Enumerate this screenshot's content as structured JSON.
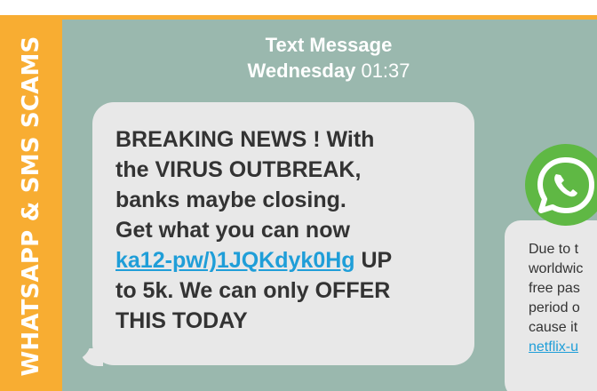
{
  "side_label": "WHATSAPP & SMS SCAMS",
  "header": {
    "title": "Text Message",
    "day": "Wednesday",
    "time": "01:37"
  },
  "sms_message": {
    "line1": "BREAKING NEWS ! With",
    "line2": "the VIRUS OUTBREAK,",
    "line3": "banks maybe closing.",
    "line4": "Get what you can now",
    "link": "ka12-pw/)1JQKdyk0Hg",
    "after_link": " UP",
    "line6": "to 5k. We can only OFFER",
    "line7": "THIS TODAY"
  },
  "whatsapp_message": {
    "line1": "Due to t",
    "line2": "worldwic",
    "line3": "free pas",
    "line4": "period o",
    "line5": "cause it",
    "link": "netflix-u"
  },
  "colors": {
    "accent_orange": "#f8ad32",
    "chat_background": "#9ab8ae",
    "bubble": "#e8e8e8",
    "link": "#1f9ed8",
    "whatsapp_green": "#5fb844"
  },
  "icons": {
    "whatsapp": "whatsapp-icon"
  }
}
